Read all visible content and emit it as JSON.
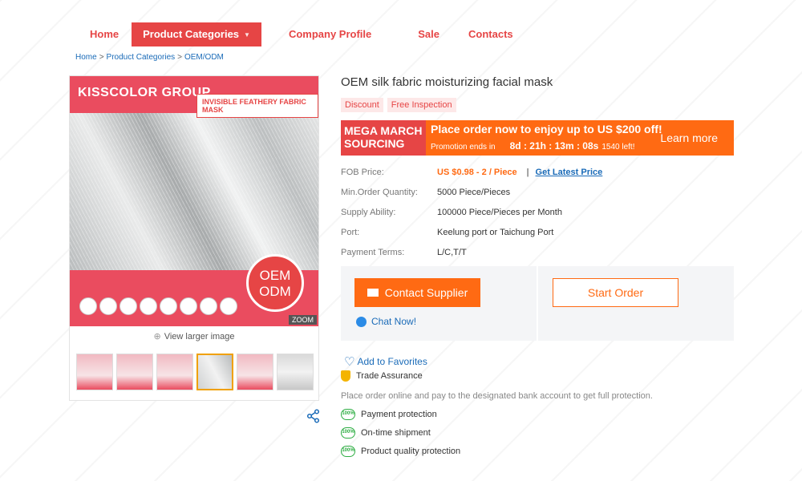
{
  "nav": {
    "items": [
      {
        "label": "Home"
      },
      {
        "label": "Product Categories"
      },
      {
        "label": "Company Profile"
      },
      {
        "label": "Sale"
      },
      {
        "label": "Contacts"
      }
    ]
  },
  "breadcrumb": {
    "items": [
      "Home",
      "Product Categories",
      "OEM/ODM"
    ],
    "separator": ">"
  },
  "gallery": {
    "brand": "KISSCOLOR GROUP",
    "tag": "INVISIBLE FEATHERY FABRIC MASK",
    "badge_line1": "OEM",
    "badge_line2": "ODM",
    "zoom": "ZOOM",
    "view_larger": "View larger image",
    "thumb_count": 6,
    "selected_thumb": 4
  },
  "product": {
    "title": "OEM silk fabric moisturizing facial mask",
    "badges": [
      "Discount",
      "Free Inspection"
    ]
  },
  "promo": {
    "line1": "MEGA MARCH",
    "line2": "SOURCING",
    "headline": "Place order now to enjoy up to US $200 off!",
    "sub": "Promotion ends in",
    "timer": "8d : 21h : 13m : 08s",
    "left": "1540 left!",
    "cta": "Learn more"
  },
  "specs": {
    "fob_label": "FOB Price:",
    "fob_value": "US $0.98 - 2 / Piece",
    "fob_sep": "|",
    "fob_link": "Get Latest Price",
    "moq_label": "Min.Order Quantity:",
    "moq_value": "5000 Piece/Pieces",
    "supply_label": "Supply Ability:",
    "supply_value": "100000 Piece/Pieces per Month",
    "port_label": "Port:",
    "port_value": "Keelung port or Taichung Port",
    "payment_label": "Payment Terms:",
    "payment_value": "L/C,T/T"
  },
  "actions": {
    "contact": "Contact Supplier",
    "start": "Start Order",
    "chat": "Chat Now!"
  },
  "assurance": {
    "favorites": "Add to Favorites",
    "title": "Trade Assurance",
    "desc": "Place order online and pay to the designated bank account to get full protection.",
    "icon_text": "100%",
    "items": [
      "Payment protection",
      "On-time shipment",
      "Product quality protection"
    ]
  },
  "colors": {
    "brand_red": "#e64545",
    "promo_orange": "#ff6a13",
    "link_blue": "#1a6bb8",
    "check_green": "#2fae44"
  }
}
